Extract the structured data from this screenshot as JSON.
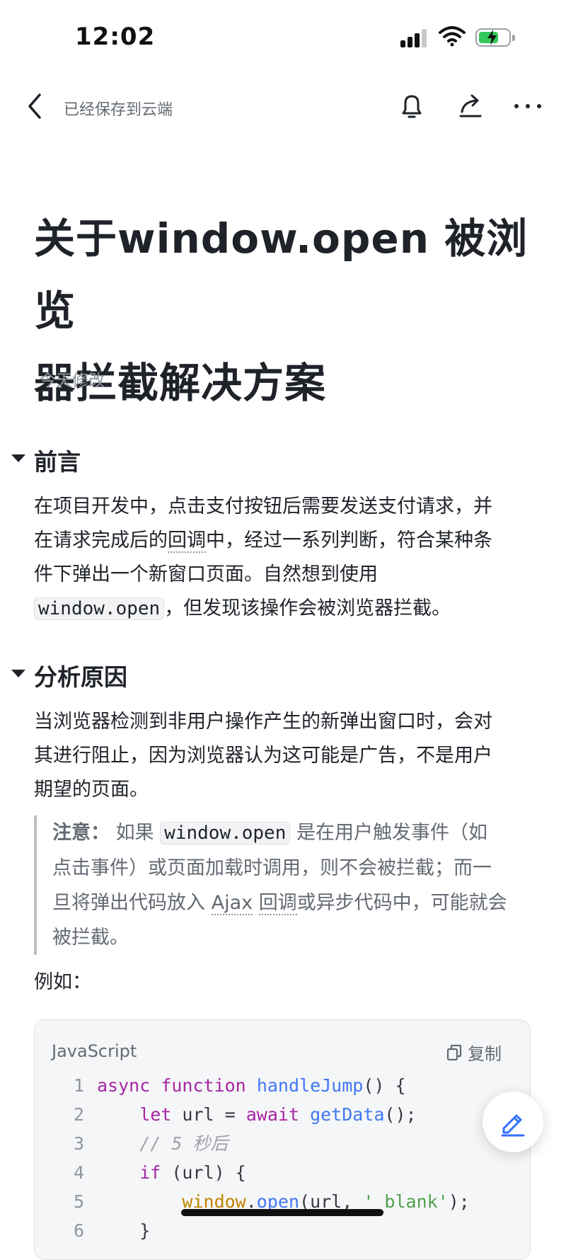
{
  "status_bar": {
    "time": "12:02",
    "battery_level": 0.72
  },
  "nav": {
    "title": "已经保存到云端"
  },
  "doc": {
    "title_lines": [
      "关于window.open 被浏览",
      "器拦截解决方案"
    ],
    "modified": "今天修改"
  },
  "sections": [
    {
      "heading": "前言",
      "lines": [
        "在项目开发中，点击支付按钮后需要发送支付请求，并",
        [
          "在请求完成后的",
          "回调",
          "中，经过一系列判断，符合某种条"
        ],
        "件下弹出一个新窗口页面。自然想到使用",
        [
          "window.open",
          "，但发现该操作会被浏览器拦截。"
        ]
      ]
    },
    {
      "heading": "分析原因",
      "lines": [
        "当浏览器检测到非用户操作产生的新弹出窗口时，会对",
        "其进行阻止，因为浏览器认为这可能是广告，不是用户",
        "期望的页面。"
      ]
    }
  ],
  "quote": {
    "label": "注意：",
    "l1_pre": " 如果 ",
    "l1_code": "window.open",
    "l1_post": " 是在用户触发事件（如",
    "l2": "点击事件）或页面加载时调用，则不会被拦截；而一",
    "l3_pre": "旦将弹出代码放入 ",
    "l3_ajax": "Ajax",
    "l3_mid": " ",
    "l3_cb": "回调",
    "l3_post": "或异步代码中，可能就会",
    "l4": "被拦截。"
  },
  "example_label": "例如：",
  "code_block": {
    "language": "JavaScript",
    "copy_label": "复制",
    "lines": [
      {
        "n": "1",
        "tokens": [
          [
            "kw",
            "async"
          ],
          [
            "pl",
            " "
          ],
          [
            "kw",
            "function"
          ],
          [
            "pl",
            " "
          ],
          [
            "fn",
            "handleJump"
          ],
          [
            "pl",
            "() {"
          ]
        ]
      },
      {
        "n": "2",
        "tokens": [
          [
            "pl",
            "    "
          ],
          [
            "kw",
            "let"
          ],
          [
            "pl",
            " url = "
          ],
          [
            "kw",
            "await"
          ],
          [
            "pl",
            " "
          ],
          [
            "fn",
            "getData"
          ],
          [
            "pl",
            "();"
          ]
        ]
      },
      {
        "n": "3",
        "tokens": [
          [
            "pl",
            "    "
          ],
          [
            "cm",
            "// 5 秒后"
          ]
        ]
      },
      {
        "n": "4",
        "tokens": [
          [
            "pl",
            "    "
          ],
          [
            "kw",
            "if"
          ],
          [
            "pl",
            " (url) {"
          ]
        ]
      },
      {
        "n": "5",
        "tokens": [
          [
            "pl",
            "        "
          ],
          [
            "obj",
            "window"
          ],
          [
            "pl",
            "."
          ],
          [
            "fn",
            "open"
          ],
          [
            "pl",
            "(url, "
          ],
          [
            "st",
            "'_blank'"
          ],
          [
            "pl",
            ");"
          ]
        ]
      },
      {
        "n": "6",
        "tokens": [
          [
            "pl",
            "    }"
          ]
        ]
      }
    ]
  }
}
